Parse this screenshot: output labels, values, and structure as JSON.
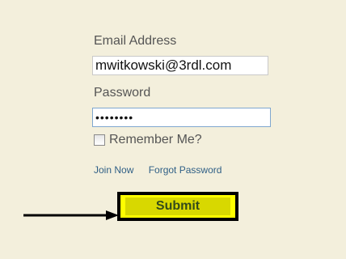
{
  "form": {
    "email_label": "Email Address",
    "email_value": "mwitkowski@3rdl.com",
    "password_label": "Password",
    "password_value": "••••••••",
    "remember_label": "Remember Me?",
    "remember_checked": false,
    "join_now_label": "Join Now",
    "forgot_password_label": "Forgot Password",
    "submit_label": "Submit"
  },
  "colors": {
    "panel_background": "#f3efdc",
    "submit_background": "#ffff00",
    "submit_inner": "#d8d800",
    "link": "#2f5f86",
    "arrow": "#000000"
  },
  "icons": {
    "pointer": "right-arrow-icon"
  }
}
